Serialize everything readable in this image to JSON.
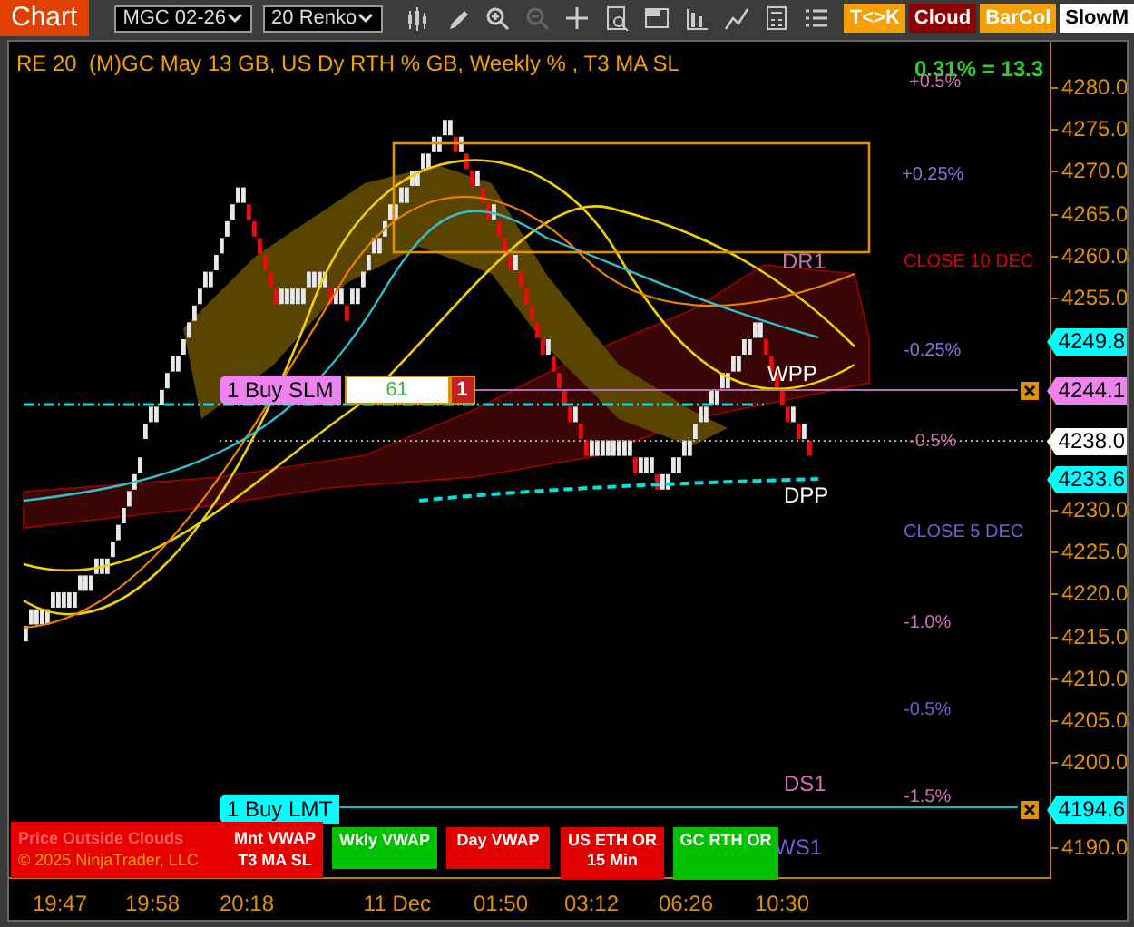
{
  "toolbar": {
    "tab": "Chart",
    "instrument": "MGC 02-26",
    "interval": "20 Renko",
    "buttons": [
      {
        "label": "T<>K",
        "color": "#f5a000"
      },
      {
        "label": "Cloud",
        "color": "#8b0000"
      },
      {
        "label": "BarCol",
        "color": "#f5a000"
      },
      {
        "label": "SlowM",
        "color": "#ffffff"
      }
    ]
  },
  "chart": {
    "title": "RE 20  (M)GC May 13 GB, US Dy RTH % GB, Weekly % , T3 MA SL",
    "change": "0.31% = 13.3",
    "level_labels": [
      {
        "text": "+0.5%",
        "color": "#d070b0"
      },
      {
        "text": "+0.25%",
        "color": "#9070e0"
      },
      {
        "text": "CLOSE 10 DEC",
        "color": "#e00000"
      },
      {
        "text": "-0.25%",
        "color": "#9070e0"
      },
      {
        "text": "-0.5%",
        "color": "#d070b0"
      },
      {
        "text": "CLOSE 5 DEC",
        "color": "#7060d0"
      },
      {
        "text": "-1.0%",
        "color": "#d070b0"
      },
      {
        "text": "-0.5%",
        "color": "#7060d0"
      },
      {
        "text": "-1.5%",
        "color": "#d070b0"
      }
    ],
    "pivots": [
      {
        "text": "DR1",
        "color": "#d070b0"
      },
      {
        "text": "WPP",
        "color": "#ffffff"
      },
      {
        "text": "DPP",
        "color": "#ffffff"
      },
      {
        "text": "DS1",
        "color": "#d070b0"
      },
      {
        "text": "WS1",
        "color": "#7060d0"
      }
    ],
    "orders": [
      {
        "label": "1 Buy SLM",
        "color": "#ee82ee",
        "quantity": "61",
        "count": "1"
      },
      {
        "label": "1 Buy LMT",
        "color": "#00ffff"
      }
    ],
    "price_tags": [
      {
        "text": "4249.8",
        "color": "#00ffff"
      },
      {
        "text": "4244.1",
        "color": "#ee82ee"
      },
      {
        "text": "4238.0",
        "color": "#ffffff"
      },
      {
        "text": "4233.6",
        "color": "#00ffff"
      },
      {
        "text": "4194.6",
        "color": "#00ffff"
      }
    ],
    "y_axis": [
      "4280.0",
      "4275.0",
      "4270.0",
      "4265.0",
      "4260.0",
      "4255.0",
      "4230.0",
      "4225.0",
      "4220.0",
      "4215.0",
      "4210.0",
      "4205.0",
      "4200.0",
      "4190.0"
    ],
    "x_axis": [
      "19:47",
      "19:58",
      "20:18",
      "11 Dec",
      "01:50",
      "03:12",
      "06:26",
      "10:30"
    ],
    "status": {
      "alert": "Price Outside Clouds",
      "copyright": "© 2025 NinjaTrader, LLC",
      "lines": [
        "Mnt VWAP",
        "T3 MA SL"
      ]
    },
    "indicators": [
      {
        "label": "Wkly VWAP",
        "color": "#00c000"
      },
      {
        "label": "Day VWAP",
        "color": "#e00000"
      },
      {
        "label": "US ETH OR 15 Min",
        "color": "#e00000"
      },
      {
        "label": "GC RTH OR",
        "color": "#00c000"
      }
    ]
  }
}
